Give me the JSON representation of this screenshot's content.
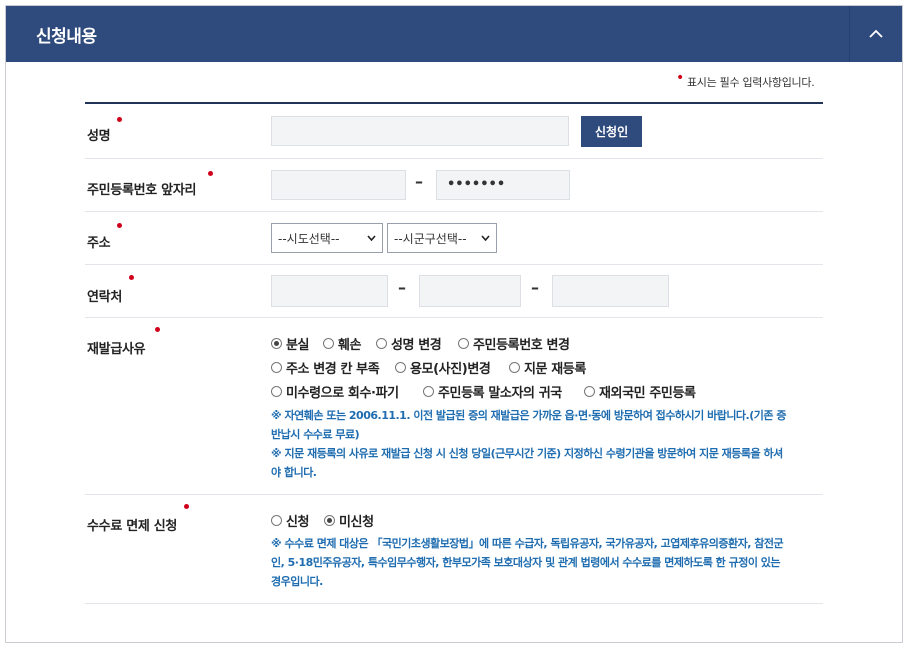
{
  "header": {
    "title": "신청내용",
    "toggle_icon": "chevron-up-icon"
  },
  "required_note": "표시는 필수 입력사항입니다.",
  "fields": {
    "name": {
      "label": "성명",
      "button": "신청인"
    },
    "rrn": {
      "label": "주민등록번호 앞자리",
      "dash": "–",
      "back_value": "•••••••"
    },
    "address": {
      "label": "주소",
      "sido": "--시도선택--",
      "sigungu": "--시군구선택--"
    },
    "phone": {
      "label": "연락처",
      "dash1": "–",
      "dash2": "–"
    },
    "reason": {
      "label": "재발급사유",
      "options": [
        "분실",
        "훼손",
        "성명 변경",
        "주민등록번호 변경",
        "주소 변경 칸 부족",
        "용모(사진)변경",
        "지문 재등록",
        "미수령으로 회수·파기",
        "주민등록 말소자의 귀국",
        "재외국민 주민등록"
      ],
      "selected": "분실",
      "note1": "※ 자연훼손 또는 2006.11.1. 이전 발급된 증의 재발급은 가까운 읍·면·동에 방문하여 접수하시기 바랍니다.(기존 증",
      "note1b": "반납시 수수료 무료)",
      "note2": "※ 지문 재등록의 사유로 재발급 신청 시 신청 당일(근무시간 기준) 지정하신 수령기관을 방문하여 지문 재등록을 하셔",
      "note2b": "야 합니다."
    },
    "fee": {
      "label": "수수료 면제 신청",
      "options": [
        "신청",
        "미신청"
      ],
      "selected": "미신청",
      "note1": "※ 수수료 면제 대상은 「국민기초생활보장법」에 따른 수급자, 독립유공자, 국가유공자, 고엽제후유의증환자, 참전군",
      "note2": "인, 5·18민주유공자, 특수임무수행자, 한부모가족 보호대상자 및 관계 법령에서 수수료를 면제하도록 한 규정이 있는",
      "note3": "경우입니다."
    }
  }
}
